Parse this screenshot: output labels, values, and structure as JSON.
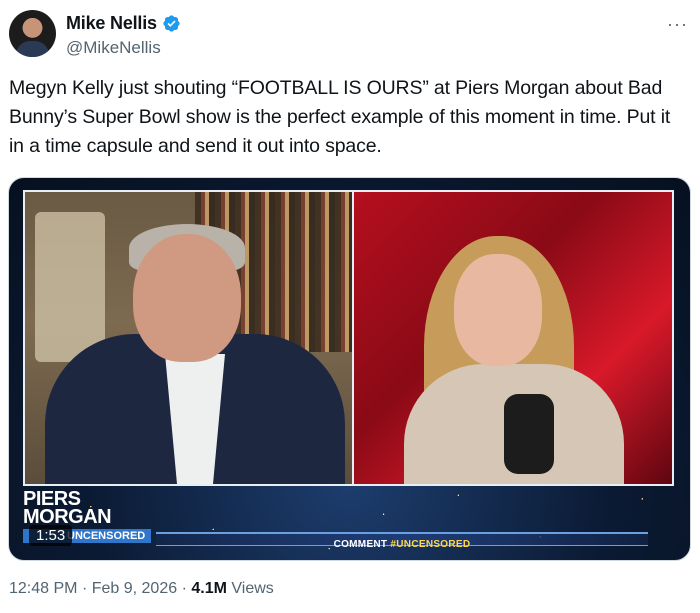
{
  "author": {
    "display_name": "Mike Nellis",
    "handle": "@MikeNellis",
    "verified": true
  },
  "more_icon": "more-horizontal-icon",
  "tweet_text": "Megyn Kelly just shouting “FOOTBALL IS OURS” at Piers Morgan about Bad Bunny’s Super Bowl show is the perfect example of this moment in time. Put it in a time capsule and send it out into space.",
  "video": {
    "duration": "1:53",
    "logo_line1": "PIERS",
    "logo_line2": "MORGAN",
    "logo_tag": "UNCENSORED",
    "ticker_prefix": "COMMENT ",
    "ticker_hashtag": "#UNCENSORED"
  },
  "meta": {
    "time": "12:48 PM",
    "date": "Feb 9, 2026",
    "views_count": "4.1M",
    "views_label": "Views"
  },
  "colors": {
    "verified": "#1d9bf0",
    "secondary_text": "#536471"
  }
}
